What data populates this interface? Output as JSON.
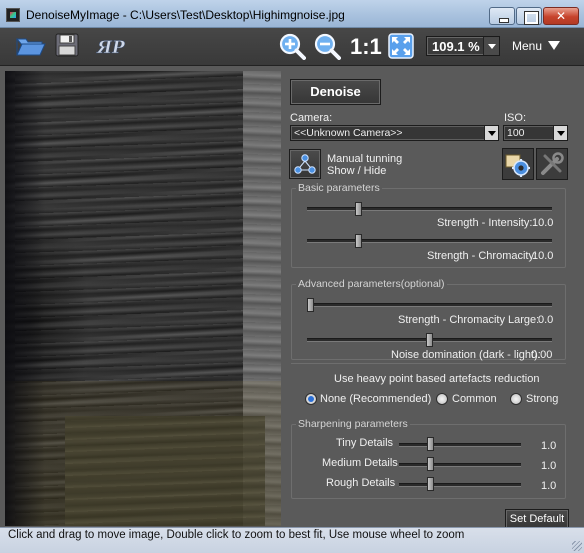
{
  "window": {
    "title": "DenoiseMyImage - C:\\Users\\Test\\Desktop\\Highimgnoise.jpg",
    "close_glyph": "✕"
  },
  "toolbar": {
    "open_icon": "folder-open-icon",
    "save_icon": "floppy-disk-icon",
    "zoom_in_icon": "zoom-in-icon",
    "zoom_out_icon": "zoom-out-icon",
    "actual_size_label": "1:1",
    "fit_icon": "fit-to-window-icon",
    "zoom_value": "109.1 %",
    "menu_label": "Menu"
  },
  "panel": {
    "denoise_label": "Denoise",
    "camera_label": "Camera:",
    "camera_value": "<<Unknown Camera>>",
    "iso_label": "ISO:",
    "iso_value": "100",
    "manual_tuning_line1": "Manual tunning",
    "manual_tuning_line2": "Show / Hide",
    "basic": {
      "title": "Basic parameters",
      "intensity_label": "Strength - Intensity:",
      "intensity_value": "10.0",
      "intensity_fraction": 0.2,
      "chromacity_label": "Strength - Chromacity:",
      "chromacity_value": "10.0",
      "chromacity_fraction": 0.2
    },
    "advanced": {
      "title": "Advanced parameters(optional)",
      "chroma_large_label": "Strength - Chromacity Large:",
      "chroma_large_value": "0.0",
      "chroma_large_fraction": 0.0,
      "noise_dom_label": "Noise domination (dark - light):",
      "noise_dom_value": "0.00",
      "noise_dom_fraction": 0.5
    },
    "artefacts": {
      "title": "Use heavy point based artefacts reduction",
      "options": [
        "None (Recommended)",
        "Common",
        "Strong"
      ],
      "selected": "None (Recommended)"
    },
    "sharpening": {
      "title": "Sharpening parameters",
      "tiny_label": "Tiny Details",
      "tiny_value": "1.0",
      "medium_label": "Medium Details",
      "medium_value": "1.0",
      "rough_label": "Rough Details",
      "rough_value": "1.0"
    },
    "set_default_label": "Set Default"
  },
  "status": {
    "text": "Click and drag to move image, Double click to zoom to best fit, Use mouse wheel to zoom"
  },
  "colors": {
    "panel_bg": "#5a5a5a",
    "toolbar_bg": "#3f3f3f",
    "titlebar": "#a9c2de",
    "radio_selected": "#2a6fd6"
  }
}
